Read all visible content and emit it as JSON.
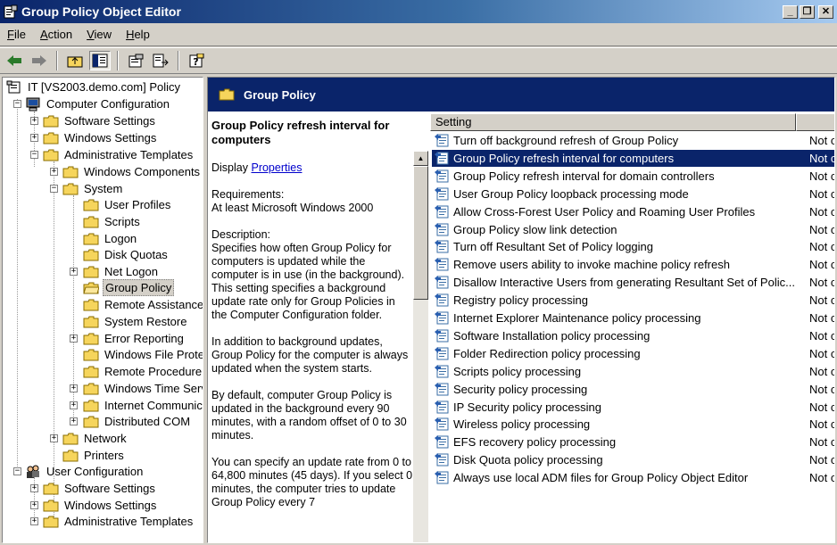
{
  "window": {
    "title": "Group Policy Object Editor"
  },
  "menu": [
    {
      "label": "File",
      "accel": "F",
      "rest": "ile"
    },
    {
      "label": "Action",
      "accel": "A",
      "rest": "ction"
    },
    {
      "label": "View",
      "accel": "V",
      "rest": "iew"
    },
    {
      "label": "Help",
      "accel": "H",
      "rest": "elp"
    }
  ],
  "tree": {
    "root": "IT [VS2003.demo.com] Policy",
    "computer_configuration": "Computer Configuration",
    "cc_software_settings": "Software Settings",
    "cc_windows_settings": "Windows Settings",
    "cc_administrative_templates": "Administrative Templates",
    "windows_components": "Windows Components",
    "system": "System",
    "user_profiles": "User Profiles",
    "scripts": "Scripts",
    "logon": "Logon",
    "disk_quotas": "Disk Quotas",
    "net_logon": "Net Logon",
    "group_policy": "Group Policy",
    "remote_assistance": "Remote Assistance",
    "system_restore": "System Restore",
    "error_reporting": "Error Reporting",
    "windows_file_protection": "Windows File Prote",
    "remote_procedure": "Remote Procedure",
    "windows_time_service": "Windows Time Serv",
    "internet_communication": "Internet Communic",
    "distributed_com": "Distributed COM",
    "network": "Network",
    "printers": "Printers",
    "user_configuration": "User Configuration",
    "uc_software_settings": "Software Settings",
    "uc_windows_settings": "Windows Settings",
    "uc_administrative_templates": "Administrative Templates"
  },
  "right": {
    "band_title": "Group Policy",
    "desc_title": "Group Policy refresh interval for computers",
    "display_label": "Display",
    "properties_link": "Properties",
    "requirements": "Requirements:",
    "requirements_value": "At least Microsoft Windows 2000",
    "description_label": "Description:",
    "description_p1": "Specifies how often Group Policy for computers is updated while the computer is in use (in the background). This setting specifies a background update rate only for Group Policies in the Computer Configuration folder.",
    "description_p2": "In addition to background updates, Group Policy for the computer is always updated when the system starts.",
    "description_p3": "By default, computer Group Policy is updated in the background every 90 minutes, with a random offset of 0 to 30 minutes.",
    "description_p4": "You can specify an update rate from 0 to 64,800 minutes (45 days). If you select 0 minutes, the computer tries to update Group Policy every 7"
  },
  "list": {
    "col_setting": "Setting",
    "col_state": "",
    "rows": [
      {
        "setting": "Turn off background refresh of Group Policy",
        "state": "Not c"
      },
      {
        "setting": "Group Policy refresh interval for computers",
        "state": "Not c"
      },
      {
        "setting": "Group Policy refresh interval for domain controllers",
        "state": "Not c"
      },
      {
        "setting": "User Group Policy loopback processing mode",
        "state": "Not c"
      },
      {
        "setting": "Allow Cross-Forest User Policy and Roaming User Profiles",
        "state": "Not c"
      },
      {
        "setting": "Group Policy slow link detection",
        "state": "Not c"
      },
      {
        "setting": "Turn off Resultant Set of Policy logging",
        "state": "Not c"
      },
      {
        "setting": "Remove users ability to invoke machine policy refresh",
        "state": "Not c"
      },
      {
        "setting": "Disallow Interactive Users from generating Resultant Set of Polic...",
        "state": "Not c"
      },
      {
        "setting": "Registry policy processing",
        "state": "Not c"
      },
      {
        "setting": "Internet Explorer Maintenance policy processing",
        "state": "Not c"
      },
      {
        "setting": "Software Installation policy processing",
        "state": "Not c"
      },
      {
        "setting": "Folder Redirection policy processing",
        "state": "Not c"
      },
      {
        "setting": "Scripts policy processing",
        "state": "Not c"
      },
      {
        "setting": "Security policy processing",
        "state": "Not c"
      },
      {
        "setting": "IP Security policy processing",
        "state": "Not c"
      },
      {
        "setting": "Wireless policy processing",
        "state": "Not c"
      },
      {
        "setting": "EFS recovery policy processing",
        "state": "Not c"
      },
      {
        "setting": "Disk Quota policy processing",
        "state": "Not c"
      },
      {
        "setting": "Always use local ADM files for Group Policy Object Editor",
        "state": "Not c"
      }
    ],
    "selected_index": 1
  },
  "colors": {
    "title_active": "#0a246a",
    "selection": "#0a246a",
    "face": "#d4d0c8"
  }
}
